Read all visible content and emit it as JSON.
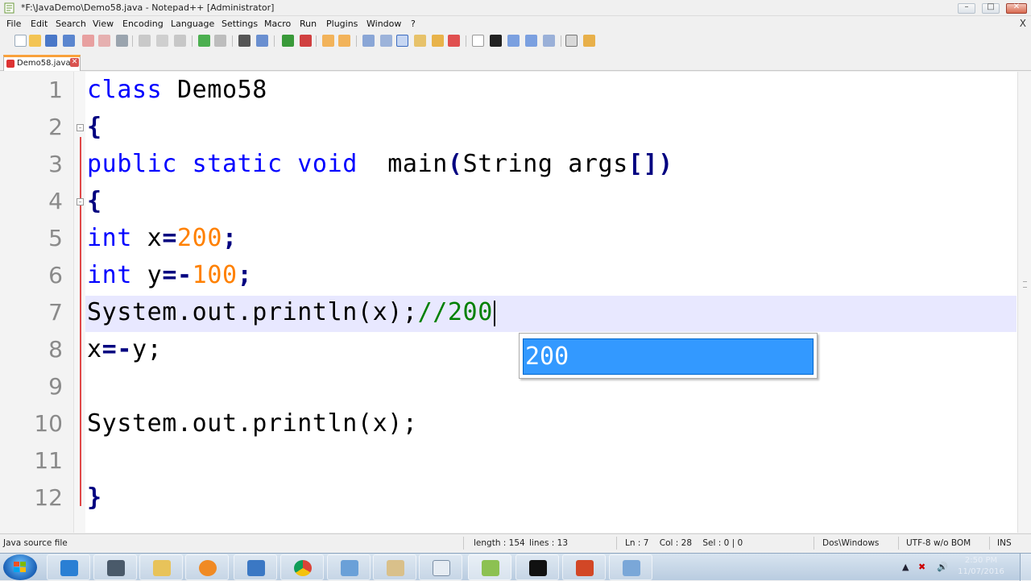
{
  "window": {
    "title": "*F:\\JavaDemo\\Demo58.java - Notepad++ [Administrator]",
    "controls": {
      "minimize": "–",
      "maximize": "□",
      "close": "✕"
    }
  },
  "menu": {
    "items": [
      "File",
      "Edit",
      "Search",
      "View",
      "Encoding",
      "Language",
      "Settings",
      "Macro",
      "Run",
      "Plugins",
      "Window",
      "?"
    ],
    "close_glyph": "X"
  },
  "toolbar": {
    "icons": [
      "new-file",
      "open-file",
      "save",
      "save-all",
      "close",
      "close-all",
      "print",
      "cut",
      "copy",
      "paste",
      "undo",
      "redo",
      "find",
      "replace",
      "zoom-in",
      "zoom-out",
      "sync-vertical",
      "sync-horizontal",
      "word-wrap",
      "show-all-chars",
      "indent-guide",
      "user-defined-language",
      "function-list",
      "record-macro",
      "stop-record",
      "playback-macro",
      "playback-multiple",
      "save-macro",
      "spell-check",
      "spell-settings"
    ]
  },
  "tab": {
    "label": "Demo58.java",
    "close_glyph": "✕"
  },
  "editor": {
    "line_numbers": [
      "1",
      "2",
      "3",
      "4",
      "5",
      "6",
      "7",
      "8",
      "9",
      "10",
      "11",
      "12"
    ],
    "lines": {
      "l1_kw": "class",
      "l1_rest": " Demo58",
      "l2": "{",
      "l3_kw": "public static void",
      "l3_rest": "  main",
      "l3_paren_open": "(",
      "l3_mid": "String args",
      "l3_brackets": "[])",
      "l4": "{",
      "l5_kw": "int",
      "l5_var": " x",
      "l5_op": "=",
      "l5_num": "200",
      "l5_end": ";",
      "l6_kw": "int",
      "l6_var": " y",
      "l6_op": "=-",
      "l6_num": "100",
      "l6_end": ";",
      "l7_code": "System.out.println(x);",
      "l7_comment": "//200",
      "l8_var": "x",
      "l8_op": "=-",
      "l8_rest": "y;",
      "l9": "",
      "l10_code": "System.out.println(x);",
      "l11": "",
      "l12": "}"
    },
    "autocomplete": {
      "suggestion": "200"
    }
  },
  "status": {
    "file_type": "Java source file",
    "length": "length : 154",
    "lines": "lines : 13",
    "position": "Ln : 7    Col : 28    Sel : 0 | 0",
    "eol": "Dos\\Windows",
    "encoding": "UTF-8 w/o BOM",
    "mode": "INS"
  },
  "taskbar": {
    "apps": [
      "internet-explorer",
      "calculator",
      "file-explorer",
      "media-player",
      "remote-desktop",
      "chrome",
      "control-panel",
      "paint",
      "window-app",
      "notepad-plus-plus",
      "command-prompt",
      "powerpoint",
      "network"
    ],
    "clock": {
      "time": "2:50 PM",
      "date": "11/07/2016"
    }
  },
  "colors": {
    "keyword": "#0000ff",
    "number": "#ff8000",
    "comment": "#008000",
    "operator": "#000080",
    "current_line": "#e8e8ff",
    "autocomplete_highlight": "#3399ff"
  }
}
